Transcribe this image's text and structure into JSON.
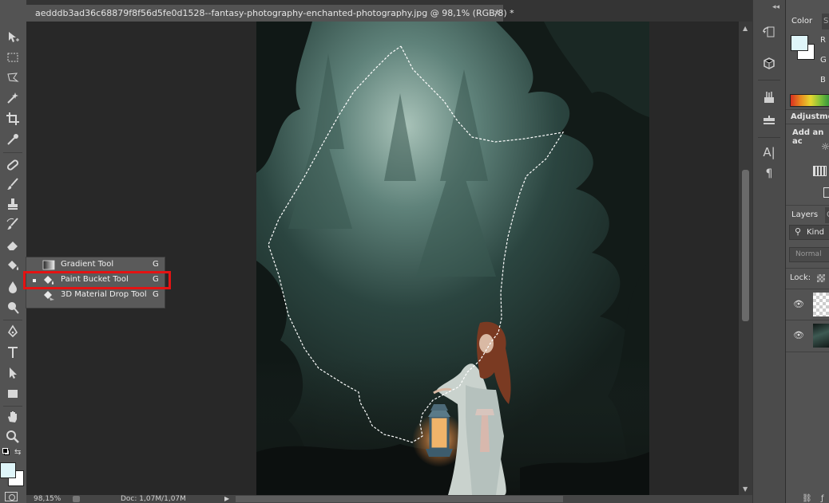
{
  "document": {
    "tab_title": "aedddb3ad36c68879f8f56d5fe0d1528--fantasy-photography-enchanted-photography.jpg @ 98,1% (RGB/8) *",
    "close_glyph": "×"
  },
  "tool_flyout": {
    "items": [
      {
        "label": "Gradient Tool",
        "shortcut": "G",
        "icon": "gradient-icon",
        "selected": false
      },
      {
        "label": "Paint Bucket Tool",
        "shortcut": "G",
        "icon": "paint-bucket-icon",
        "selected": true
      },
      {
        "label": "3D Material Drop Tool",
        "shortcut": "G",
        "icon": "3d-material-drop-icon",
        "selected": false
      }
    ]
  },
  "status_bar": {
    "zoom": "98,15%",
    "doc_size": "Doc: 1,07M/1,07M"
  },
  "color_panel": {
    "tab_active": "Color",
    "tab_inactive": "Sw",
    "channels": [
      "R",
      "G",
      "B"
    ],
    "foreground_color": "#dff5f9",
    "background_color": "#ffffff"
  },
  "adjustments_panel": {
    "title": "Adjustmen",
    "subtitle": "Add an ac"
  },
  "layers_panel": {
    "tab_active": "Layers",
    "tab_inactive": "C",
    "filter_label": "Kind",
    "blend_mode": "Normal",
    "lock_label": "Lock:"
  },
  "colors": {
    "highlight_box": "#e41313",
    "ui_panel": "#535353",
    "canvas_bg": "#282828"
  }
}
